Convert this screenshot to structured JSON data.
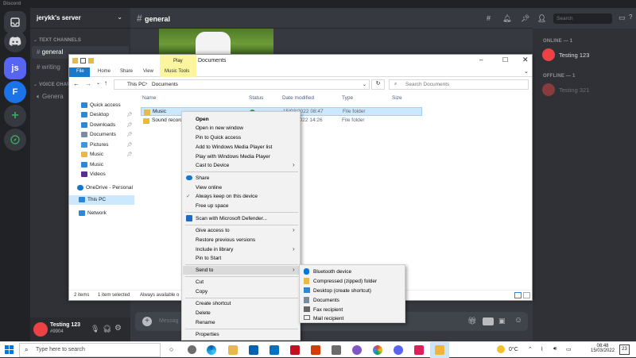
{
  "discord": {
    "app_title": "Discord",
    "server_name": "jerykk's server",
    "text_channels_label": "TEXT CHANNELS",
    "channel_general": "general",
    "channel_writing": "writing",
    "voice_channels_label": "VOICE CHANN",
    "voice_general": "Genera",
    "header_channel": "general",
    "search_placeholder": "Search",
    "online_label": "ONLINE — 1",
    "offline_label": "OFFLINE — 1",
    "member_online": "Testing 123",
    "member_offline": "Testing 321",
    "username": "Testing 123",
    "user_tag": "#9904",
    "message_placeholder": "Messag",
    "server_initial": "js",
    "server_f": "F"
  },
  "explorer": {
    "window_title": "Documents",
    "ribbon_contextual": "Play",
    "tabs": [
      "File",
      "Home",
      "Share",
      "View",
      "Music Tools"
    ],
    "address": [
      "This PC",
      "Documents"
    ],
    "search_placeholder": "Search Documents",
    "nav": [
      {
        "label": "Quick access",
        "pinned": false
      },
      {
        "label": "Desktop",
        "pinned": true
      },
      {
        "label": "Downloads",
        "pinned": true
      },
      {
        "label": "Documents",
        "pinned": true
      },
      {
        "label": "Pictures",
        "pinned": true
      },
      {
        "label": "Music",
        "pinned": true
      },
      {
        "label": "Music",
        "pinned": false
      },
      {
        "label": "Videos",
        "pinned": false
      },
      {
        "label": "OneDrive - Personal",
        "pinned": false
      },
      {
        "label": "This PC",
        "pinned": false
      },
      {
        "label": "Network",
        "pinned": false
      }
    ],
    "columns": [
      "Name",
      "Status",
      "Date modified",
      "Type",
      "Size"
    ],
    "files": [
      {
        "name": "Music",
        "date": "15/03/2022 08:47",
        "type": "File folder"
      },
      {
        "name": "Sound record",
        "date": "15/03/2022 14:26",
        "type": "File folder"
      }
    ],
    "status_items": "2 items",
    "status_selected": "1 item selected",
    "status_available": "Always available o"
  },
  "context_menu": {
    "open": "Open",
    "open_new_window": "Open in new window",
    "pin_quick": "Pin to Quick access",
    "add_wmp": "Add to Windows Media Player list",
    "play_wmp": "Play with Windows Media Player",
    "cast": "Cast to Device",
    "share": "Share",
    "view_online": "View online",
    "always_keep": "Always keep on this device",
    "free_up": "Free up space",
    "scan": "Scan with Microsoft Defender...",
    "give_access": "Give access to",
    "restore": "Restore previous versions",
    "include_library": "Include in library",
    "pin_start": "Pin to Start",
    "send_to": "Send to",
    "cut": "Cut",
    "copy": "Copy",
    "create_shortcut": "Create shortcut",
    "delete": "Delete",
    "rename": "Rename",
    "properties": "Properties"
  },
  "sendto_menu": {
    "bluetooth": "Bluetooth device",
    "compressed": "Compressed (zipped) folder",
    "desktop": "Desktop (create shortcut)",
    "documents": "Documents",
    "fax": "Fax recipient",
    "mail": "Mail recipient"
  },
  "taskbar": {
    "search_placeholder": "Type here to search",
    "temperature": "0°C",
    "time": "08:48",
    "date": "15/03/2022",
    "notifications": "23"
  },
  "colors": {
    "discord_dark": "#202225",
    "discord_channels": "#2f3136",
    "discord_main": "#36393f",
    "selected_row": "#cce8ff",
    "accent_blue": "#0078d7"
  }
}
